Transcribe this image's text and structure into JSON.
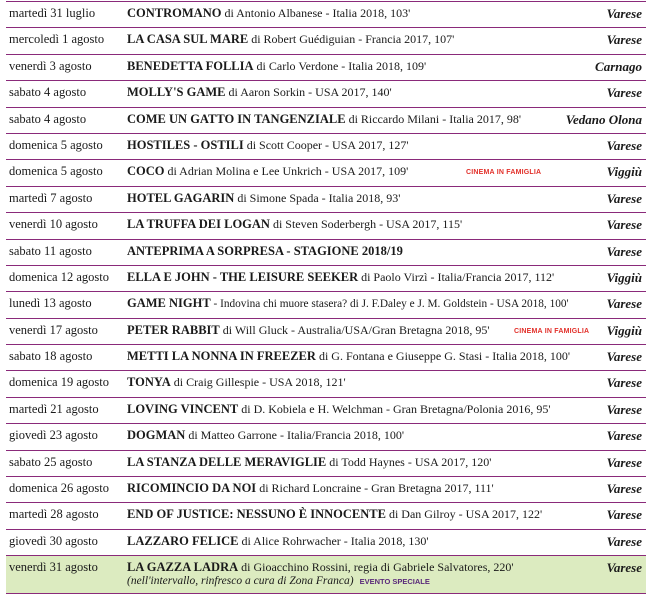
{
  "rows": [
    {
      "date": "martedì 31 luglio",
      "title": "CONTROMANO",
      "details": " di Antonio Albanese - Italia 2018, 103'",
      "city": "Varese"
    },
    {
      "date": "mercoledì 1 agosto",
      "title": "LA CASA SUL MARE",
      "details": " di Robert Guédiguian - Francia 2017, 107'",
      "city": "Varese"
    },
    {
      "date": "venerdì 3 agosto",
      "title": "BENEDETTA FOLLIA",
      "details": " di Carlo Verdone - Italia 2018, 109'",
      "city": "Carnago"
    },
    {
      "date": "sabato 4 agosto",
      "title": "MOLLY'S GAME",
      "details": " di Aaron Sorkin - USA 2017, 140'",
      "city": "Varese"
    },
    {
      "date": "sabato 4 agosto",
      "title": "COME UN GATTO IN TANGENZIALE",
      "details": " di Riccardo Milani - Italia 2017, 98'",
      "city": "Vedano Olona"
    },
    {
      "date": "domenica 5 agosto",
      "title": "HOSTILES - OSTILI",
      "details": " di Scott Cooper - USA 2017, 127'",
      "city": "Varese"
    },
    {
      "date": "domenica 5 agosto",
      "title": "COCO",
      "details": " di Adrian Molina e Lee Unkrich - USA 2017, 109'",
      "city": "Viggiù",
      "tag": "CINEMA IN FAMIGLIA"
    },
    {
      "date": "martedì 7 agosto",
      "title": "HOTEL GAGARIN",
      "details": " di Simone Spada - Italia 2018, 93'",
      "city": "Varese"
    },
    {
      "date": "venerdì 10 agosto",
      "title": "LA TRUFFA DEI LOGAN",
      "details": " di Steven Soderbergh - USA 2017, 115'",
      "city": "Varese"
    },
    {
      "date": "sabato 11 agosto",
      "title": "ANTEPRIMA A SORPRESA - STAGIONE 2018/19",
      "details": "",
      "city": "Varese"
    },
    {
      "date": "domenica 12 agosto",
      "title": "ELLA E JOHN - THE LEISURE SEEKER",
      "details": " di Paolo Virzì - Italia/Francia 2017, 112'",
      "city": "Viggiù"
    },
    {
      "date": "lunedì 13 agosto",
      "title": "GAME NIGHT",
      "details": " - Indovina chi muore stasera? di J. F.Daley e  J. M. Goldstein - USA 2018, 100'",
      "city": "Varese"
    },
    {
      "date": "venerdì 17 agosto",
      "title": "PETER RABBIT",
      "details": " di Will Gluck - Australia/USA/Gran Bretagna 2018, 95'",
      "city": "Viggiù",
      "tag": "CINEMA IN FAMIGLIA"
    },
    {
      "date": "sabato 18 agosto",
      "title": "METTI LA NONNA IN FREEZER",
      "details": " di G. Fontana e Giuseppe G. Stasi - Italia 2018, 100'",
      "city": "Varese"
    },
    {
      "date": "domenica 19 agosto",
      "title": "TONYA",
      "details": " di Craig Gillespie - USA 2018, 121'",
      "city": "Varese"
    },
    {
      "date": "martedì 21 agosto",
      "title": "LOVING VINCENT",
      "details": " di D. Kobiela e H. Welchman - Gran Bretagna/Polonia 2016, 95'",
      "city": "Varese"
    },
    {
      "date": "giovedì 23 agosto",
      "title": "DOGMAN",
      "details": " di Matteo Garrone - Italia/Francia 2018, 100'",
      "city": "Varese"
    },
    {
      "date": "sabato 25 agosto",
      "title": "LA STANZA DELLE MERAVIGLIE",
      "details": " di Todd Haynes - USA 2017, 120'",
      "city": "Varese"
    },
    {
      "date": "domenica 26 agosto",
      "title": "RICOMINCIO DA NOI",
      "details": " di Richard Loncraine - Gran Bretagna 2017, 111'",
      "city": "Varese"
    },
    {
      "date": "martedì 28 agosto",
      "title": "END OF JUSTICE: NESSUNO È INNOCENTE",
      "details": " di Dan Gilroy - USA 2017, 122'",
      "city": "Varese"
    },
    {
      "date": "giovedì 30 agosto",
      "title": "LAZZARO FELICE",
      "details": " di Alice Rohrwacher - Italia 2018, 130'",
      "city": "Varese"
    },
    {
      "date": "venerdì 31 agosto",
      "title": "LA GAZZA LADRA",
      "details": "  di Gioacchino Rossini, regia di Gabriele Salvatores, 220'",
      "city": "Varese",
      "note": "(nell'intervallo, rinfresco a cura di Zona Franca)",
      "note_tag": "EVENTO SPECIALE",
      "highlight": true
    }
  ],
  "colors": {
    "rule": "#8a2a7a",
    "tag": "#e2302a",
    "highlight_bg": "#dcebc0",
    "special_tag": "#5a2a7a"
  }
}
